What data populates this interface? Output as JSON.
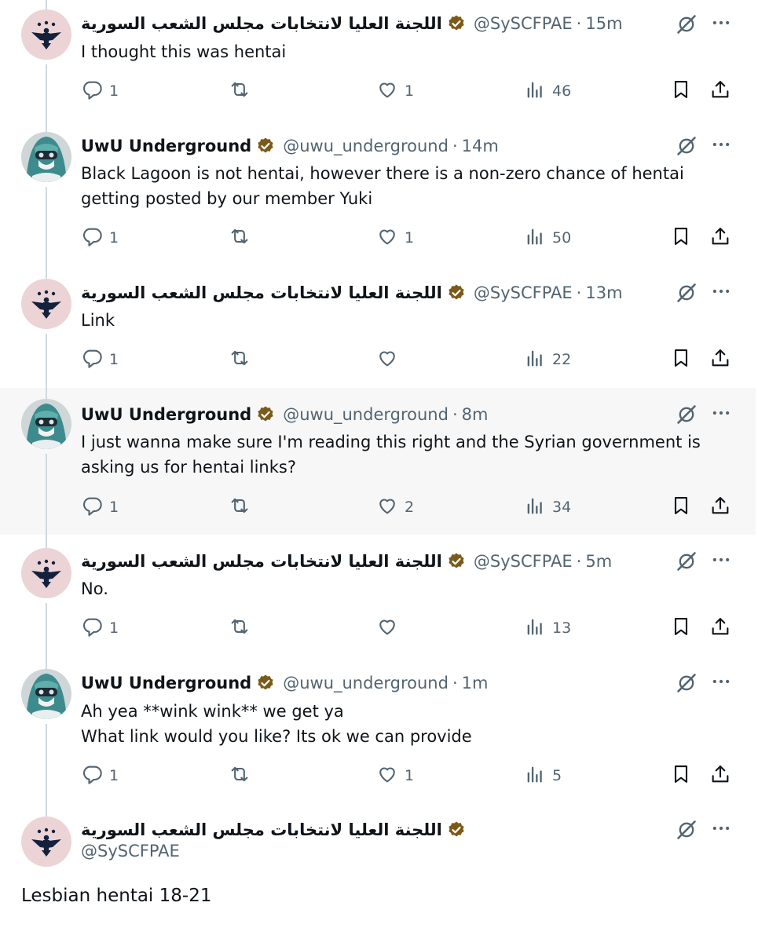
{
  "thread": [
    {
      "author": "اللجنة العليا لانتخابات مجلس الشعب السورية",
      "handle": "@SySCFPAE",
      "time": "15m",
      "lines": [
        "I thought this was hentai"
      ],
      "replies": "1",
      "retweets": "",
      "likes": "1",
      "views": "46"
    },
    {
      "author": "UwU Underground",
      "handle": "@uwu_underground",
      "time": "14m",
      "lines": [
        "Black Lagoon is not hentai, however there is a non-zero chance of hentai",
        "getting posted by our member Yuki"
      ],
      "replies": "1",
      "retweets": "",
      "likes": "1",
      "views": "50"
    },
    {
      "author": "اللجنة العليا لانتخابات مجلس الشعب السورية",
      "handle": "@SySCFPAE",
      "time": "13m",
      "lines": [
        "Link"
      ],
      "replies": "1",
      "retweets": "",
      "likes": "",
      "views": "22"
    },
    {
      "author": "UwU Underground",
      "handle": "@uwu_underground",
      "time": "8m",
      "lines": [
        "I just wanna make sure I'm reading this right and the Syrian government is",
        "asking us for hentai links?"
      ],
      "replies": "1",
      "retweets": "",
      "likes": "2",
      "views": "34"
    },
    {
      "author": "اللجنة العليا لانتخابات مجلس الشعب السورية",
      "handle": "@SySCFPAE",
      "time": "5m",
      "lines": [
        "No."
      ],
      "replies": "1",
      "retweets": "",
      "likes": "",
      "views": "13"
    },
    {
      "author": "UwU Underground",
      "handle": "@uwu_underground",
      "time": "1m",
      "lines": [
        "Ah yea **wink wink** we get ya",
        "What link would you like? Its ok we can provide"
      ],
      "replies": "1",
      "retweets": "",
      "likes": "1",
      "views": "5"
    }
  ],
  "main": {
    "author": "اللجنة العليا لانتخابات مجلس الشعب السورية",
    "handle": "@SySCFPAE",
    "text": "Lesbian hentai 18-21"
  },
  "separator": "·",
  "colors": {
    "gold_verified": "#7b5a19",
    "muted": "#536471",
    "text": "#0f1419"
  },
  "icons": [
    "reply-icon",
    "retweet-icon",
    "like-icon",
    "views-icon",
    "bookmark-icon",
    "share-icon",
    "more-icon",
    "grok-icon",
    "verified-gold-badge"
  ]
}
